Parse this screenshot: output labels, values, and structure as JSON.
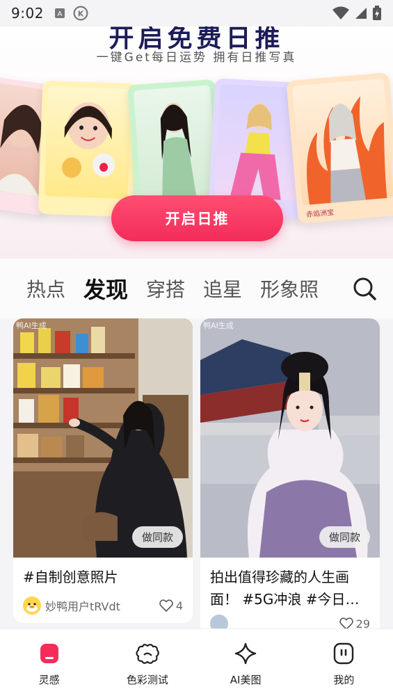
{
  "status_bar": {
    "time": "9:02"
  },
  "banner": {
    "title": "开启免费日推",
    "subtitle": "一键Get每日运势 拥有日推写真",
    "card_captions": [
      "",
      "",
      "",
      "",
      "赤焰洲宝"
    ],
    "start_button": "开启日推"
  },
  "tabs": [
    {
      "label": "热点"
    },
    {
      "label": "发现"
    },
    {
      "label": "穿搭"
    },
    {
      "label": "追星"
    },
    {
      "label": "形象照"
    }
  ],
  "active_tab": "发现",
  "posts": [
    {
      "watermark": "鸭AI生成",
      "same_button": "做同款",
      "caption": "#自制创意照片",
      "user": "妙鸭用户tRVdt",
      "likes": "4"
    },
    {
      "watermark": "鸭AI生成",
      "same_button": "做同款",
      "caption": "拍出值得珍藏的人生画面！ #5G冲浪 #今日…",
      "user": "",
      "likes": "29"
    }
  ],
  "bottom_nav": [
    {
      "label": "灵感",
      "icon": "inspiration-icon",
      "active": true
    },
    {
      "label": "色彩测试",
      "icon": "flower-icon",
      "active": false
    },
    {
      "label": "AI美图",
      "icon": "sparkle-icon",
      "active": false
    },
    {
      "label": "我的",
      "icon": "profile-icon",
      "active": false
    }
  ],
  "colors": {
    "accent": "#f32c5a",
    "title": "#1c1c5a"
  }
}
